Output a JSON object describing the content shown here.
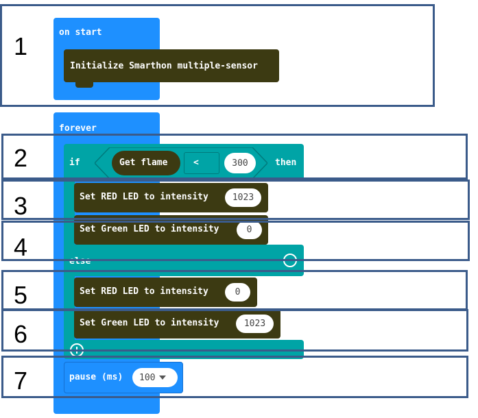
{
  "on_start": {
    "label": "on start",
    "init_block": "Initialize Smarthon multiple-sensor"
  },
  "forever": {
    "label": "forever",
    "if_block": {
      "if_label": "if",
      "reporter": "Get flame",
      "operator": "<",
      "threshold": "300",
      "then_label": "then",
      "else_label": "else"
    },
    "then_statements": [
      {
        "text": "Set RED LED to intensity",
        "value": "1023"
      },
      {
        "text": "Set Green LED to intensity",
        "value": "0"
      }
    ],
    "else_statements": [
      {
        "text": "Set RED LED to intensity",
        "value": "0"
      },
      {
        "text": "Set Green LED to intensity",
        "value": "1023"
      }
    ],
    "pause": {
      "label": "pause (ms)",
      "value": "100"
    }
  },
  "annotations": [
    "1",
    "2",
    "3",
    "4",
    "5",
    "6",
    "7"
  ],
  "colors": {
    "event_blue": "#1e90ff",
    "logic_teal": "#00a4a6",
    "extension_dark": "#3c3a12",
    "frame": "#3b5b8a"
  },
  "icons": {
    "else_collapse": "minus-circle-icon",
    "else_add": "plus-circle-icon",
    "pause_dropdown": "caret-down-icon"
  }
}
